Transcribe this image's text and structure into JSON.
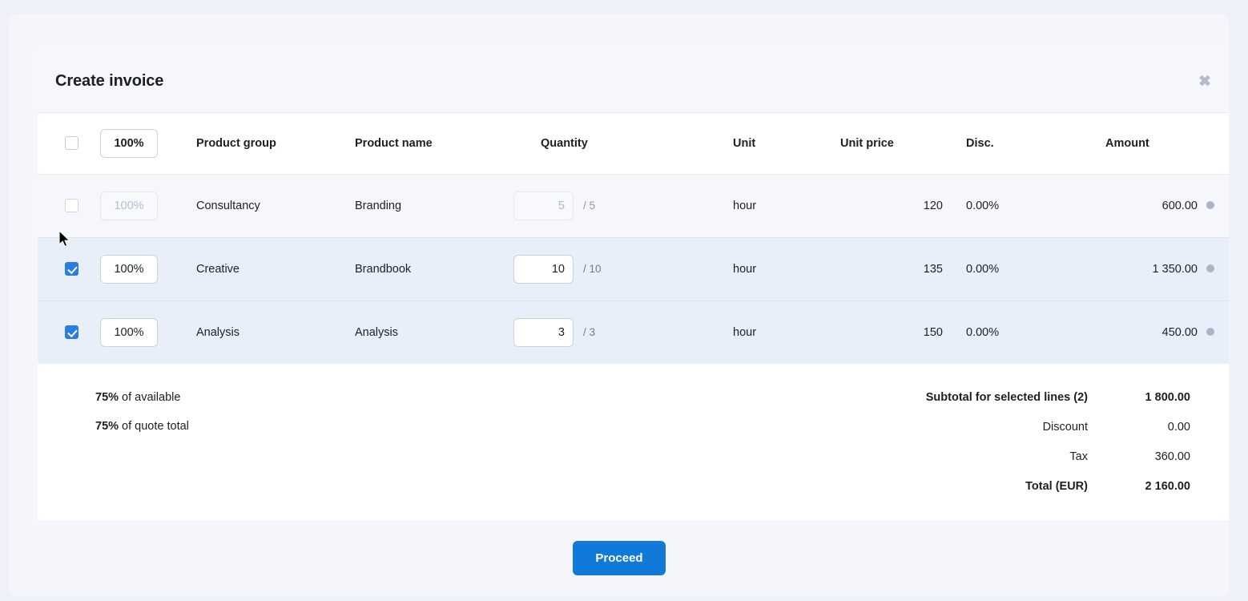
{
  "dialog": {
    "title": "Create invoice",
    "close_icon": "close-icon",
    "close_glyph": "✖"
  },
  "table": {
    "headers": {
      "select_all": "",
      "percent": "100%",
      "product_group": "Product group",
      "product_name": "Product name",
      "quantity": "Quantity",
      "unit": "Unit",
      "unit_price": "Unit price",
      "discount": "Disc.",
      "amount": "Amount"
    },
    "rows": [
      {
        "selected": false,
        "disabled": true,
        "percent": "100%",
        "product_group": "Consultancy",
        "product_name": "Branding",
        "quantity": "5",
        "quantity_max": "/ 5",
        "unit": "hour",
        "unit_price": "120",
        "discount": "0.00%",
        "amount": "600.00",
        "status_dot": "status-dot"
      },
      {
        "selected": true,
        "disabled": false,
        "percent": "100%",
        "product_group": "Creative",
        "product_name": "Brandbook",
        "quantity": "10",
        "quantity_max": "/ 10",
        "unit": "hour",
        "unit_price": "135",
        "discount": "0.00%",
        "amount": "1 350.00",
        "status_dot": "status-dot"
      },
      {
        "selected": true,
        "disabled": false,
        "percent": "100%",
        "product_group": "Analysis",
        "product_name": "Analysis",
        "quantity": "3",
        "quantity_max": "/ 3",
        "unit": "hour",
        "unit_price": "150",
        "discount": "0.00%",
        "amount": "450.00",
        "status_dot": "status-dot"
      }
    ]
  },
  "summary": {
    "left": [
      {
        "bold": "75%",
        "rest": " of available"
      },
      {
        "bold": "75%",
        "rest": " of quote total"
      }
    ],
    "totals": [
      {
        "label": "Subtotal for selected lines (2)",
        "value": "1 800.00",
        "strong": true
      },
      {
        "label": "Discount",
        "value": "0.00",
        "strong": false
      },
      {
        "label": "Tax",
        "value": "360.00",
        "strong": false
      },
      {
        "label": "Total (EUR)",
        "value": "2 160.00",
        "strong": true
      }
    ]
  },
  "footer": {
    "proceed_label": "Proceed"
  },
  "colors": {
    "accent": "#1179d8",
    "checkbox_checked": "#2a7de1",
    "row_selected_bg": "#e8eff8",
    "row_unselected_bg": "#f5f7fb",
    "page_bg": "#eef1f9",
    "status_dot": "#aab6c8"
  }
}
